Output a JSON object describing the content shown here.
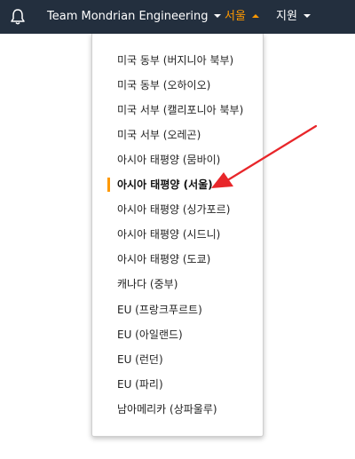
{
  "topbar": {
    "account_label": "Team Mondrian Engineering",
    "region_label": "서울",
    "support_label": "지원",
    "colors": {
      "background": "#232f3e",
      "accent": "#ff9900"
    }
  },
  "dropdown": {
    "regions": [
      {
        "label": "미국 동부 (버지니아 북부)"
      },
      {
        "label": "미국 동부 (오하이오)"
      },
      {
        "label": "미국 서부 (캘리포니아 북부)"
      },
      {
        "label": "미국 서부 (오레곤)"
      },
      {
        "label": "아시아 태평양 (뭄바이)"
      },
      {
        "label": "아시아 태평양 (서울)",
        "selected": true
      },
      {
        "label": "아시아 태평양 (싱가포르)"
      },
      {
        "label": "아시아 태평양 (시드니)"
      },
      {
        "label": "아시아 태평양 (도쿄)"
      },
      {
        "label": "캐나다 (중부)"
      },
      {
        "label": "EU (프랑크푸르트)"
      },
      {
        "label": "EU (아일랜드)"
      },
      {
        "label": "EU (런던)"
      },
      {
        "label": "EU (파리)"
      },
      {
        "label": "남아메리카 (상파울루)"
      }
    ]
  },
  "annotation": {
    "arrow_color": "#e8262a"
  }
}
